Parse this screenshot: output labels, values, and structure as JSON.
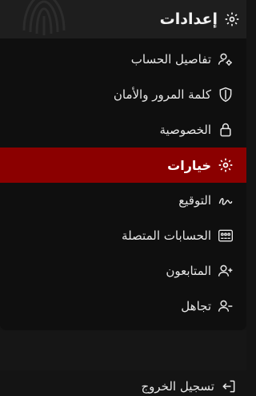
{
  "header": {
    "title": "إعدادات",
    "icon": "gear-icon"
  },
  "menu": {
    "items": [
      {
        "label": "تفاصيل الحساب",
        "icon": "user-gear-icon"
      },
      {
        "label": "كلمة المرور والأمان",
        "icon": "shield-icon"
      },
      {
        "label": "الخصوصية",
        "icon": "lock-icon"
      },
      {
        "label": "خيارات",
        "icon": "gear-icon",
        "active": true
      },
      {
        "label": "التوقيع",
        "icon": "signature-icon"
      },
      {
        "label": "الحسابات المتصلة",
        "icon": "connected-accounts-icon"
      },
      {
        "label": "المتابعون",
        "icon": "user-plus-icon"
      },
      {
        "label": "تجاهل",
        "icon": "user-minus-icon"
      }
    ]
  },
  "footer": {
    "logout_label": "تسجيل الخروج",
    "logout_icon": "logout-icon"
  },
  "colors": {
    "active_bg": "#8b0000",
    "panel_bg": "#0f0f0f",
    "header_bg": "#1e1e1e"
  }
}
